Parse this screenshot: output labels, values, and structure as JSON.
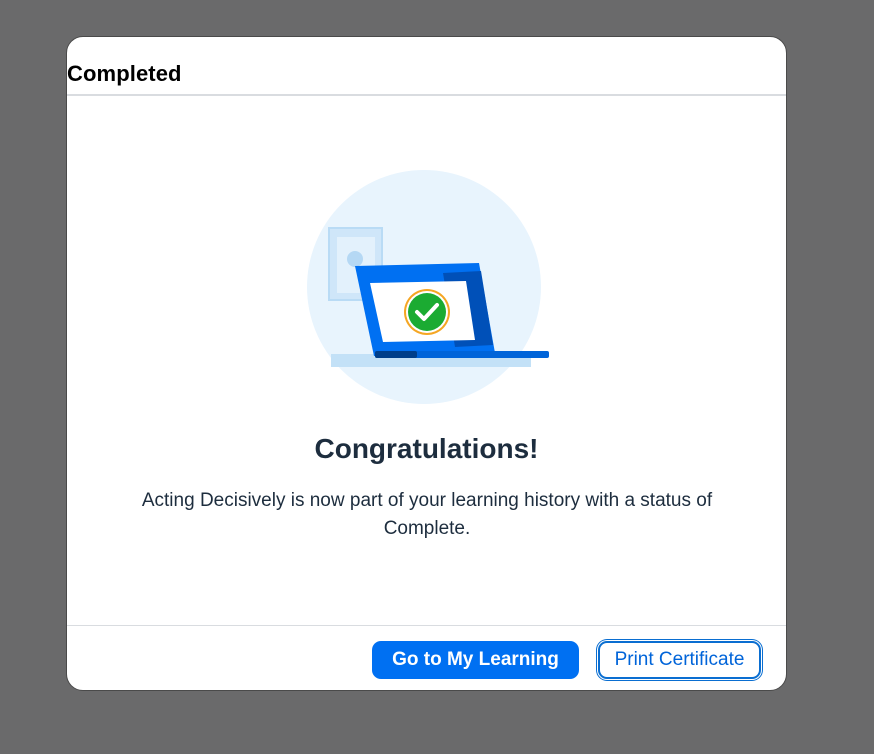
{
  "dialog": {
    "title": "Completed",
    "heading": "Congratulations!",
    "message": "Acting Decisively is now part of your learning history with a status of Complete."
  },
  "footer": {
    "primary_label": "Go to My Learning",
    "secondary_label": "Print Certificate"
  },
  "illustration": {
    "name": "laptop-success-illustration",
    "icon": "check-circle-icon"
  },
  "colors": {
    "brand_blue": "#0070f2",
    "success_green": "#1bab32",
    "overlay": "#6a6a6b"
  }
}
